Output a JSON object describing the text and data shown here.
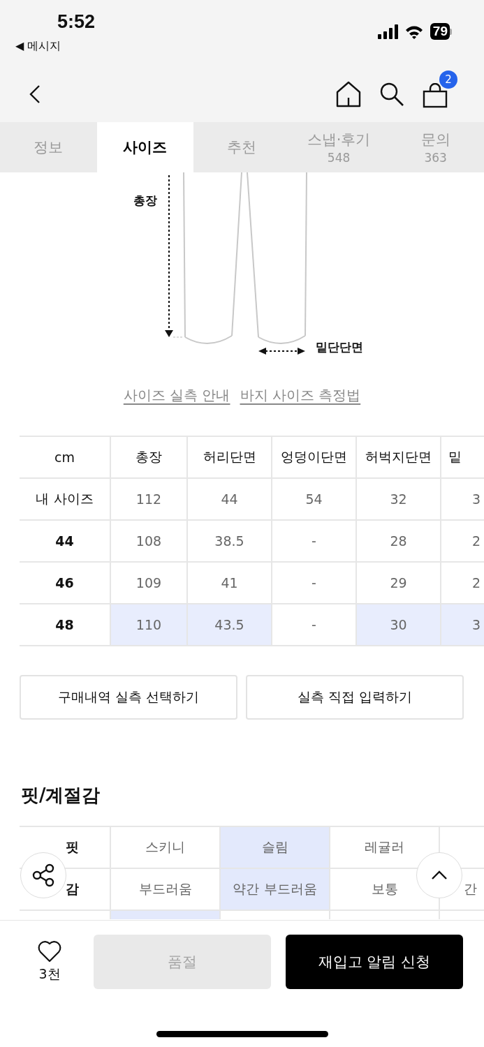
{
  "status_bar": {
    "time": "5:52",
    "back_label": "◀ 메시지",
    "battery": "79"
  },
  "nav": {
    "cart_count": "2"
  },
  "tabs": [
    {
      "label": "정보",
      "selected": false
    },
    {
      "label": "사이즈",
      "selected": true
    },
    {
      "label": "추천",
      "selected": false
    },
    {
      "label": "스냅·후기",
      "count": "548",
      "selected": false
    },
    {
      "label": "문의",
      "count": "363",
      "selected": false
    }
  ],
  "diagram": {
    "length_label": "총장",
    "hem_label": "밑단단면"
  },
  "links": [
    "사이즈 실측 안내",
    "바지 사이즈 측정법"
  ],
  "size_table": {
    "columns": [
      "cm",
      "총장",
      "허리단면",
      "엉덩이단면",
      "허벅지단면",
      "밑"
    ],
    "rows": [
      {
        "kind": "mine",
        "cells": [
          {
            "value": "내 사이즈",
            "highlighted": false
          },
          {
            "value": "112",
            "highlighted": false
          },
          {
            "value": "44",
            "highlighted": false
          },
          {
            "value": "54",
            "highlighted": false
          },
          {
            "value": "32",
            "highlighted": false
          },
          {
            "value": "3",
            "highlighted": false
          }
        ]
      },
      {
        "kind": "size",
        "cells": [
          {
            "value": "44",
            "highlighted": false
          },
          {
            "value": "108",
            "highlighted": false
          },
          {
            "value": "38.5",
            "highlighted": false
          },
          {
            "value": "-",
            "highlighted": false
          },
          {
            "value": "28",
            "highlighted": false
          },
          {
            "value": "2",
            "highlighted": false
          }
        ]
      },
      {
        "kind": "size",
        "cells": [
          {
            "value": "46",
            "highlighted": false
          },
          {
            "value": "109",
            "highlighted": false
          },
          {
            "value": "41",
            "highlighted": false
          },
          {
            "value": "-",
            "highlighted": false
          },
          {
            "value": "29",
            "highlighted": false
          },
          {
            "value": "2",
            "highlighted": false
          }
        ]
      },
      {
        "kind": "size",
        "cells": [
          {
            "value": "48",
            "highlighted": false
          },
          {
            "value": "110",
            "highlighted": true
          },
          {
            "value": "43.5",
            "highlighted": true
          },
          {
            "value": "-",
            "highlighted": false
          },
          {
            "value": "30",
            "highlighted": true
          },
          {
            "value": "3",
            "highlighted": true
          }
        ]
      }
    ]
  },
  "buttons": [
    "구매내역 실측 선택하기",
    "실측 직접 입력하기"
  ],
  "fit_section": {
    "title": "핏/계절감",
    "rows": [
      {
        "label": "핏",
        "options": [
          {
            "label": "스키니",
            "selected": false
          },
          {
            "label": "슬림",
            "selected": true
          },
          {
            "label": "레귤러",
            "selected": false
          },
          {
            "selected": false
          }
        ]
      },
      {
        "label": "감",
        "options": [
          {
            "label": "부드러움",
            "selected": false
          },
          {
            "label": "약간 부드러움",
            "selected": true
          },
          {
            "label": "보통",
            "selected": false
          },
          {
            "label": "간",
            "selected": false
          }
        ]
      },
      {
        "options": [
          {
            "selected": true
          },
          {
            "selected": false
          },
          {
            "selected": false
          },
          {
            "selected": false
          }
        ]
      }
    ]
  },
  "bottom_bar": {
    "likes": "3천",
    "sold_out": {
      "label": "품절",
      "disabled": true
    },
    "restock": "재입고 알림 신청"
  }
}
